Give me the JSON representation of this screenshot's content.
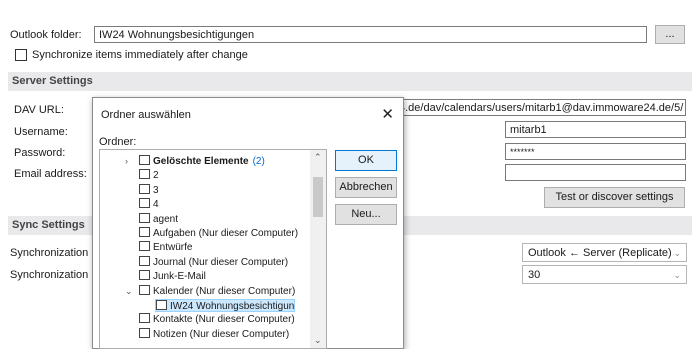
{
  "form": {
    "outlook_folder_label": "Outlook folder:",
    "outlook_folder_value": "IW24 Wohnungsbesichtigungen",
    "browse_label": "...",
    "sync_immediately_label": "Synchronize items immediately after change"
  },
  "server": {
    "section_label": "Server Settings",
    "dav_url_label": "DAV URL:",
    "dav_url_value": "4.de/dav/calendars/users/mitarb1@dav.immoware24.de/5/",
    "username_label": "Username:",
    "username_value": "mitarb1",
    "password_label": "Password:",
    "password_value": "*******",
    "email_label": "Email address:",
    "email_value": "",
    "test_button_label": "Test or discover settings"
  },
  "sync": {
    "section_label": "Sync Settings",
    "mode_label": "Synchronization",
    "mode_value": "Outlook ← Server (Replicate)",
    "interval_label": "Synchronization",
    "interval_value": "30"
  },
  "dialog": {
    "title": "Ordner auswählen",
    "close_glyph": "✕",
    "folder_label": "Ordner:",
    "ok_label": "OK",
    "cancel_label": "Abbrechen",
    "new_label": "Neu...",
    "tree": [
      {
        "label": "Gelöschte Elemente",
        "count": "(2)",
        "bold": true,
        "icon": "trash-icon",
        "expander": "›"
      },
      {
        "label": "2",
        "icon": "folder-icon"
      },
      {
        "label": "3",
        "icon": "folder-icon"
      },
      {
        "label": "4",
        "icon": "folder-icon"
      },
      {
        "label": "agent",
        "icon": "folder-icon"
      },
      {
        "label": "Aufgaben (Nur dieser Computer)",
        "icon": "task-folder-icon"
      },
      {
        "label": "Entwürfe",
        "icon": "folder-icon"
      },
      {
        "label": "Journal (Nur dieser Computer)",
        "icon": "journal-folder-icon"
      },
      {
        "label": "Junk-E-Mail",
        "icon": "junk-folder-icon"
      },
      {
        "label": "Kalender (Nur dieser Computer)",
        "icon": "calendar-folder-icon",
        "expander": "⌄"
      },
      {
        "label": "IW24 Wohnungsbesichtigun",
        "icon": "calendar-folder-icon",
        "selected": true
      },
      {
        "label": "Kontakte (Nur dieser Computer)",
        "icon": "contacts-folder-icon"
      },
      {
        "label": "Notizen (Nur dieser Computer)",
        "icon": "notes-folder-icon"
      }
    ]
  },
  "colors": {
    "section_bg": "#e9e9ec",
    "selection_bg": "#cce8ff",
    "link_blue": "#0066cc"
  }
}
